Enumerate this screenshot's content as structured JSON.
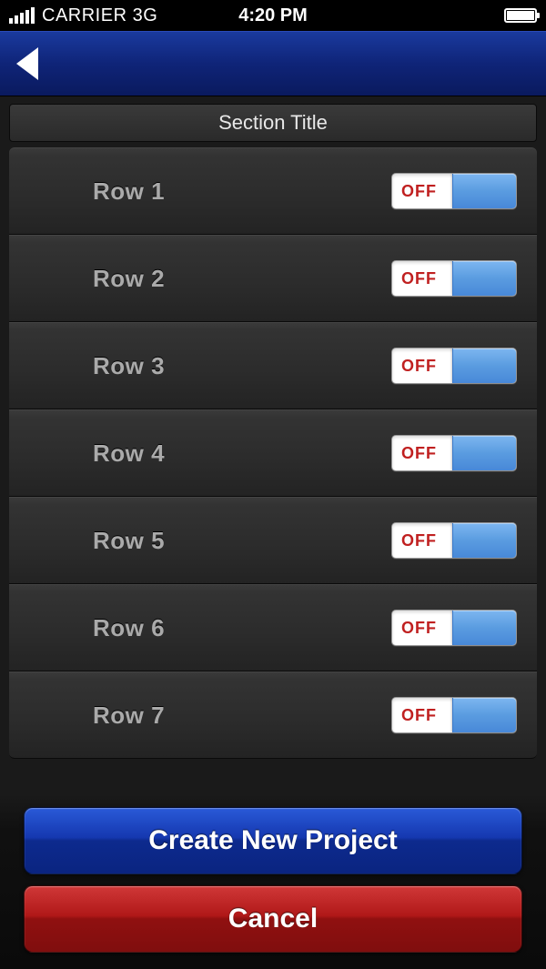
{
  "status": {
    "carrier": "CARRIER  3G",
    "time": "4:20 PM"
  },
  "section": {
    "title": "Section Title"
  },
  "rows": [
    {
      "label": "Row 1",
      "toggle_text": "OFF"
    },
    {
      "label": "Row 2",
      "toggle_text": "OFF"
    },
    {
      "label": "Row 3",
      "toggle_text": "OFF"
    },
    {
      "label": "Row 4",
      "toggle_text": "OFF"
    },
    {
      "label": "Row 5",
      "toggle_text": "OFF"
    },
    {
      "label": "Row 6",
      "toggle_text": "OFF"
    },
    {
      "label": "Row 7",
      "toggle_text": "OFF"
    }
  ],
  "buttons": {
    "primary": "Create New Project",
    "cancel": "Cancel"
  }
}
